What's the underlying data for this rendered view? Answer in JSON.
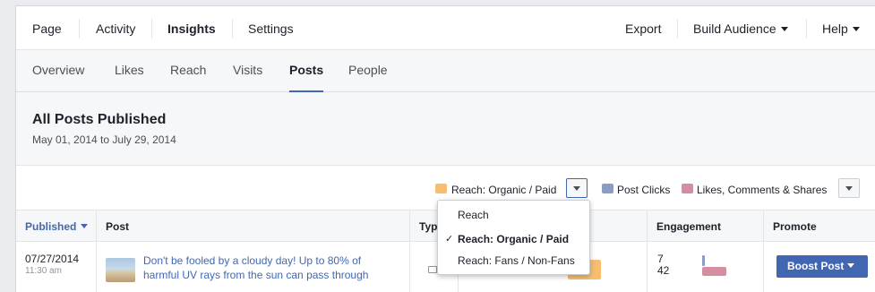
{
  "topnav": {
    "page": "Page",
    "activity": "Activity",
    "insights": "Insights",
    "settings": "Settings",
    "export": "Export",
    "build_audience": "Build Audience",
    "help": "Help"
  },
  "subnav": {
    "overview": "Overview",
    "likes": "Likes",
    "reach": "Reach",
    "visits": "Visits",
    "posts": "Posts",
    "people": "People"
  },
  "header": {
    "title": "All Posts Published",
    "date_range": "May 01, 2014 to July 29, 2014"
  },
  "legend": {
    "reach_label": "Reach: Organic / Paid",
    "post_clicks_label": "Post Clicks",
    "engagement_label": "Likes, Comments & Shares",
    "colors": {
      "reach": "#f7be6f",
      "post_clicks": "#8b9dc3",
      "engagement": "#d48ea0"
    }
  },
  "dropdown": {
    "items": [
      "Reach",
      "Reach: Organic / Paid",
      "Reach: Fans / Non-Fans"
    ],
    "selected_index": 1,
    "check": "✓"
  },
  "table": {
    "columns": {
      "published": "Published",
      "post": "Post",
      "type": "Typ",
      "engagement": "Engagement",
      "promote": "Promote"
    },
    "rows": [
      {
        "date": "07/27/2014",
        "time": "11:30 am",
        "post_line1": "Don't be fooled by a cloudy day! Up to 80% of",
        "post_line2": "harmful UV rays from the sun can pass through",
        "engagement_clicks": "7",
        "engagement_likes": "42",
        "boost_label": "Boost Post"
      }
    ]
  },
  "accent": "#4267b2"
}
